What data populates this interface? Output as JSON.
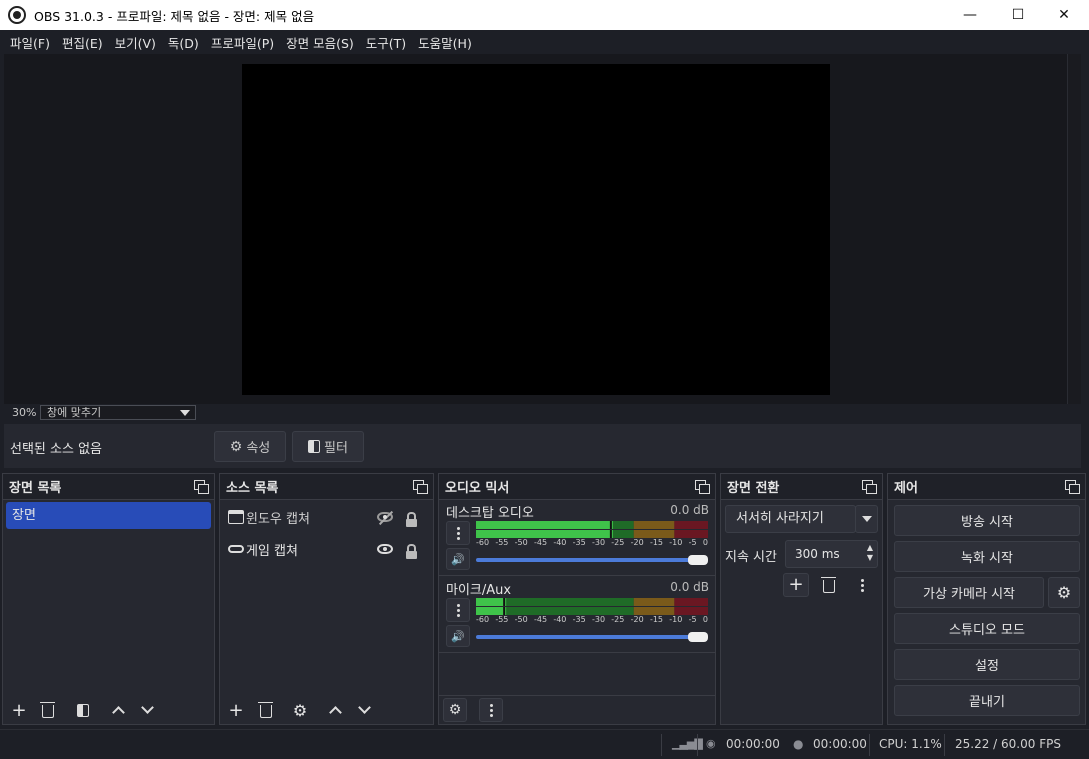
{
  "window": {
    "title": "OBS 31.0.3 - 프로파일: 제목 없음 - 장면: 제목 없음",
    "minimize": "—",
    "maximize": "☐",
    "close": "✕"
  },
  "menu": [
    "파일(F)",
    "편집(E)",
    "보기(V)",
    "독(D)",
    "프로파일(P)",
    "장면 모음(S)",
    "도구(T)",
    "도움말(H)"
  ],
  "preview": {
    "zoom_percent": "30%",
    "zoom_mode": "창에 맞추기"
  },
  "source_bar": {
    "no_source": "선택된 소스 없음",
    "properties": "속성",
    "filters": "필터"
  },
  "scenes": {
    "title": "장면 목록",
    "items": [
      "장면"
    ]
  },
  "sources": {
    "title": "소스 목록",
    "items": [
      {
        "name": "윈도우 캡쳐",
        "visible": false
      },
      {
        "name": "게임 캡쳐",
        "visible": true
      }
    ]
  },
  "mixer": {
    "title": "오디오 믹서",
    "ticks": [
      "-60",
      "-55",
      "-50",
      "-45",
      "-40",
      "-35",
      "-30",
      "-25",
      "-20",
      "-15",
      "-10",
      "-5",
      "0"
    ],
    "channels": [
      {
        "name": "데스크탑 오디오",
        "db": "0.0 dB",
        "level": 0.59
      },
      {
        "name": "마이크/Aux",
        "db": "0.0 dB",
        "level": 0.13
      }
    ]
  },
  "transitions": {
    "title": "장면 전환",
    "selected": "서서히 사라지기",
    "duration_label": "지속 시간",
    "duration_value": "300 ms"
  },
  "controls": {
    "title": "제어",
    "start_streaming": "방송 시작",
    "start_recording": "녹화 시작",
    "start_virtualcam": "가상 카메라 시작",
    "studio_mode": "스튜디오 모드",
    "settings": "설정",
    "exit": "끝내기"
  },
  "status": {
    "stream_time": "00:00:00",
    "record_time": "00:00:00",
    "cpu": "CPU: 1.1%",
    "fps": "25.22 / 60.00 FPS"
  },
  "colors": {
    "selection": "#284cb8",
    "meter_green": "#3fc34a",
    "meter_yellow": "#e0a328",
    "meter_red": "#c4253a",
    "slider_blue": "#4c7bd9"
  }
}
